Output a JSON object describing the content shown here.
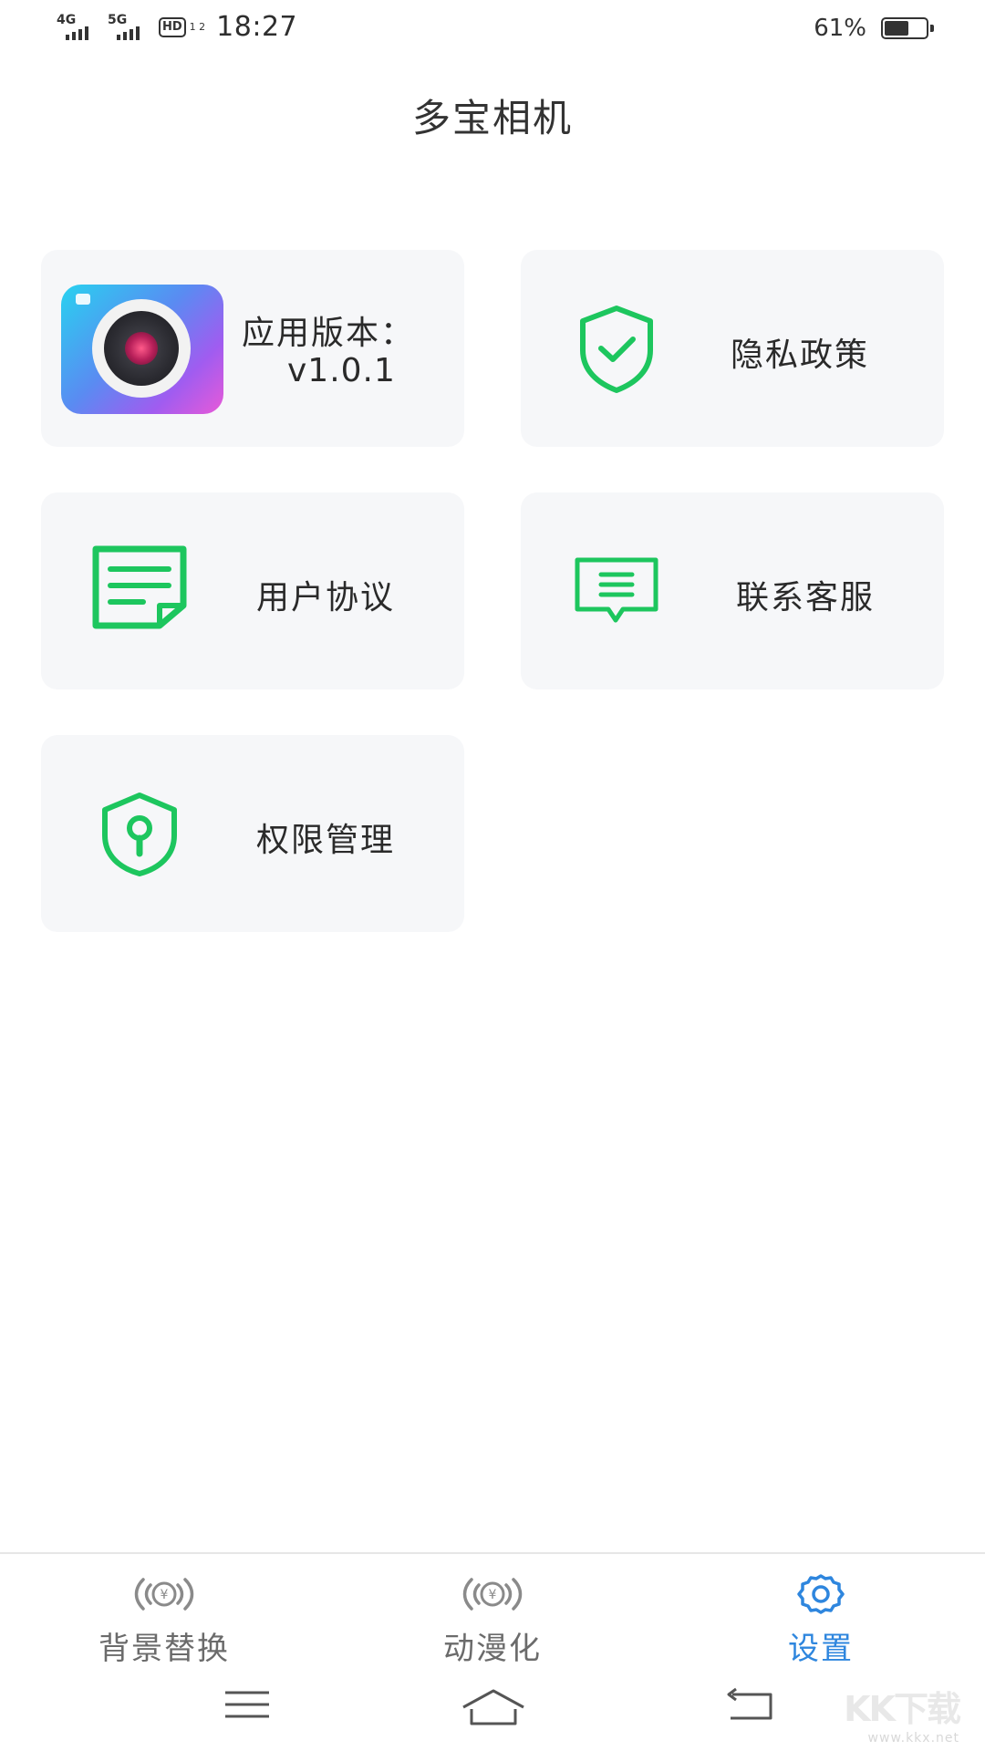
{
  "status_bar": {
    "network_1": "4G",
    "network_2": "5G",
    "hd_label": "HD",
    "hd_sub": "1 2",
    "time": "18:27",
    "battery_percent": "61%",
    "battery_level": 0.61
  },
  "header": {
    "title": "多宝相机"
  },
  "cards": {
    "version": {
      "label": "应用版本：",
      "value": "v1.0.1",
      "icon": "app-logo"
    },
    "privacy": {
      "label": "隐私政策",
      "icon": "shield-check-icon"
    },
    "agreement": {
      "label": "用户协议",
      "icon": "document-icon"
    },
    "support": {
      "label": "联系客服",
      "icon": "message-icon"
    },
    "permission": {
      "label": "权限管理",
      "icon": "shield-lock-icon"
    }
  },
  "tabs": [
    {
      "label": "背景替换",
      "icon": "broadcast-yen-icon",
      "active": false
    },
    {
      "label": "动漫化",
      "icon": "broadcast-yen-icon",
      "active": false
    },
    {
      "label": "设置",
      "icon": "gear-icon",
      "active": true
    }
  ],
  "navigation": [
    "menu-icon",
    "home-icon",
    "back-icon"
  ],
  "watermark": {
    "text": "KK下载",
    "url": "www.kkx.net"
  },
  "colors": {
    "accent_green": "#1dc65e",
    "active_blue": "#2e86de",
    "card_bg": "#f6f7f9"
  }
}
